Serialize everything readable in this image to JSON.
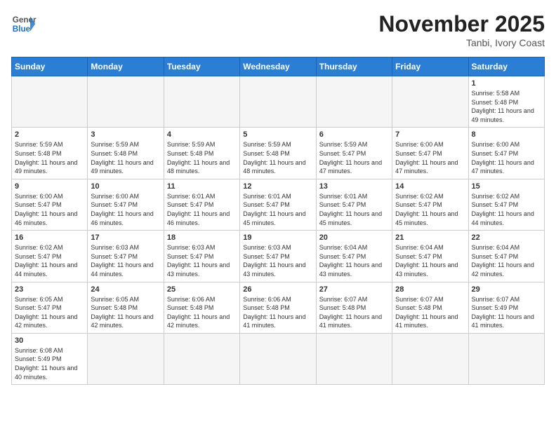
{
  "header": {
    "logo_general": "General",
    "logo_blue": "Blue",
    "month_title": "November 2025",
    "location": "Tanbi, Ivory Coast"
  },
  "weekdays": [
    "Sunday",
    "Monday",
    "Tuesday",
    "Wednesday",
    "Thursday",
    "Friday",
    "Saturday"
  ],
  "days": [
    {
      "date": "",
      "empty": true
    },
    {
      "date": "",
      "empty": true
    },
    {
      "date": "",
      "empty": true
    },
    {
      "date": "",
      "empty": true
    },
    {
      "date": "",
      "empty": true
    },
    {
      "date": "",
      "empty": true
    },
    {
      "date": "1",
      "sunrise": "5:58 AM",
      "sunset": "5:48 PM",
      "daylight": "11 hours and 49 minutes."
    },
    {
      "date": "2",
      "sunrise": "5:59 AM",
      "sunset": "5:48 PM",
      "daylight": "11 hours and 49 minutes."
    },
    {
      "date": "3",
      "sunrise": "5:59 AM",
      "sunset": "5:48 PM",
      "daylight": "11 hours and 49 minutes."
    },
    {
      "date": "4",
      "sunrise": "5:59 AM",
      "sunset": "5:48 PM",
      "daylight": "11 hours and 48 minutes."
    },
    {
      "date": "5",
      "sunrise": "5:59 AM",
      "sunset": "5:48 PM",
      "daylight": "11 hours and 48 minutes."
    },
    {
      "date": "6",
      "sunrise": "5:59 AM",
      "sunset": "5:47 PM",
      "daylight": "11 hours and 47 minutes."
    },
    {
      "date": "7",
      "sunrise": "6:00 AM",
      "sunset": "5:47 PM",
      "daylight": "11 hours and 47 minutes."
    },
    {
      "date": "8",
      "sunrise": "6:00 AM",
      "sunset": "5:47 PM",
      "daylight": "11 hours and 47 minutes."
    },
    {
      "date": "9",
      "sunrise": "6:00 AM",
      "sunset": "5:47 PM",
      "daylight": "11 hours and 46 minutes."
    },
    {
      "date": "10",
      "sunrise": "6:00 AM",
      "sunset": "5:47 PM",
      "daylight": "11 hours and 46 minutes."
    },
    {
      "date": "11",
      "sunrise": "6:01 AM",
      "sunset": "5:47 PM",
      "daylight": "11 hours and 46 minutes."
    },
    {
      "date": "12",
      "sunrise": "6:01 AM",
      "sunset": "5:47 PM",
      "daylight": "11 hours and 45 minutes."
    },
    {
      "date": "13",
      "sunrise": "6:01 AM",
      "sunset": "5:47 PM",
      "daylight": "11 hours and 45 minutes."
    },
    {
      "date": "14",
      "sunrise": "6:02 AM",
      "sunset": "5:47 PM",
      "daylight": "11 hours and 45 minutes."
    },
    {
      "date": "15",
      "sunrise": "6:02 AM",
      "sunset": "5:47 PM",
      "daylight": "11 hours and 44 minutes."
    },
    {
      "date": "16",
      "sunrise": "6:02 AM",
      "sunset": "5:47 PM",
      "daylight": "11 hours and 44 minutes."
    },
    {
      "date": "17",
      "sunrise": "6:03 AM",
      "sunset": "5:47 PM",
      "daylight": "11 hours and 44 minutes."
    },
    {
      "date": "18",
      "sunrise": "6:03 AM",
      "sunset": "5:47 PM",
      "daylight": "11 hours and 43 minutes."
    },
    {
      "date": "19",
      "sunrise": "6:03 AM",
      "sunset": "5:47 PM",
      "daylight": "11 hours and 43 minutes."
    },
    {
      "date": "20",
      "sunrise": "6:04 AM",
      "sunset": "5:47 PM",
      "daylight": "11 hours and 43 minutes."
    },
    {
      "date": "21",
      "sunrise": "6:04 AM",
      "sunset": "5:47 PM",
      "daylight": "11 hours and 43 minutes."
    },
    {
      "date": "22",
      "sunrise": "6:04 AM",
      "sunset": "5:47 PM",
      "daylight": "11 hours and 42 minutes."
    },
    {
      "date": "23",
      "sunrise": "6:05 AM",
      "sunset": "5:47 PM",
      "daylight": "11 hours and 42 minutes."
    },
    {
      "date": "24",
      "sunrise": "6:05 AM",
      "sunset": "5:48 PM",
      "daylight": "11 hours and 42 minutes."
    },
    {
      "date": "25",
      "sunrise": "6:06 AM",
      "sunset": "5:48 PM",
      "daylight": "11 hours and 42 minutes."
    },
    {
      "date": "26",
      "sunrise": "6:06 AM",
      "sunset": "5:48 PM",
      "daylight": "11 hours and 41 minutes."
    },
    {
      "date": "27",
      "sunrise": "6:07 AM",
      "sunset": "5:48 PM",
      "daylight": "11 hours and 41 minutes."
    },
    {
      "date": "28",
      "sunrise": "6:07 AM",
      "sunset": "5:48 PM",
      "daylight": "11 hours and 41 minutes."
    },
    {
      "date": "29",
      "sunrise": "6:07 AM",
      "sunset": "5:49 PM",
      "daylight": "11 hours and 41 minutes."
    },
    {
      "date": "30",
      "sunrise": "6:08 AM",
      "sunset": "5:49 PM",
      "daylight": "11 hours and 40 minutes."
    },
    {
      "date": "",
      "empty": true
    },
    {
      "date": "",
      "empty": true
    },
    {
      "date": "",
      "empty": true
    },
    {
      "date": "",
      "empty": true
    },
    {
      "date": "",
      "empty": true
    },
    {
      "date": "",
      "empty": true
    }
  ],
  "labels": {
    "sunrise": "Sunrise:",
    "sunset": "Sunset:",
    "daylight": "Daylight:"
  }
}
